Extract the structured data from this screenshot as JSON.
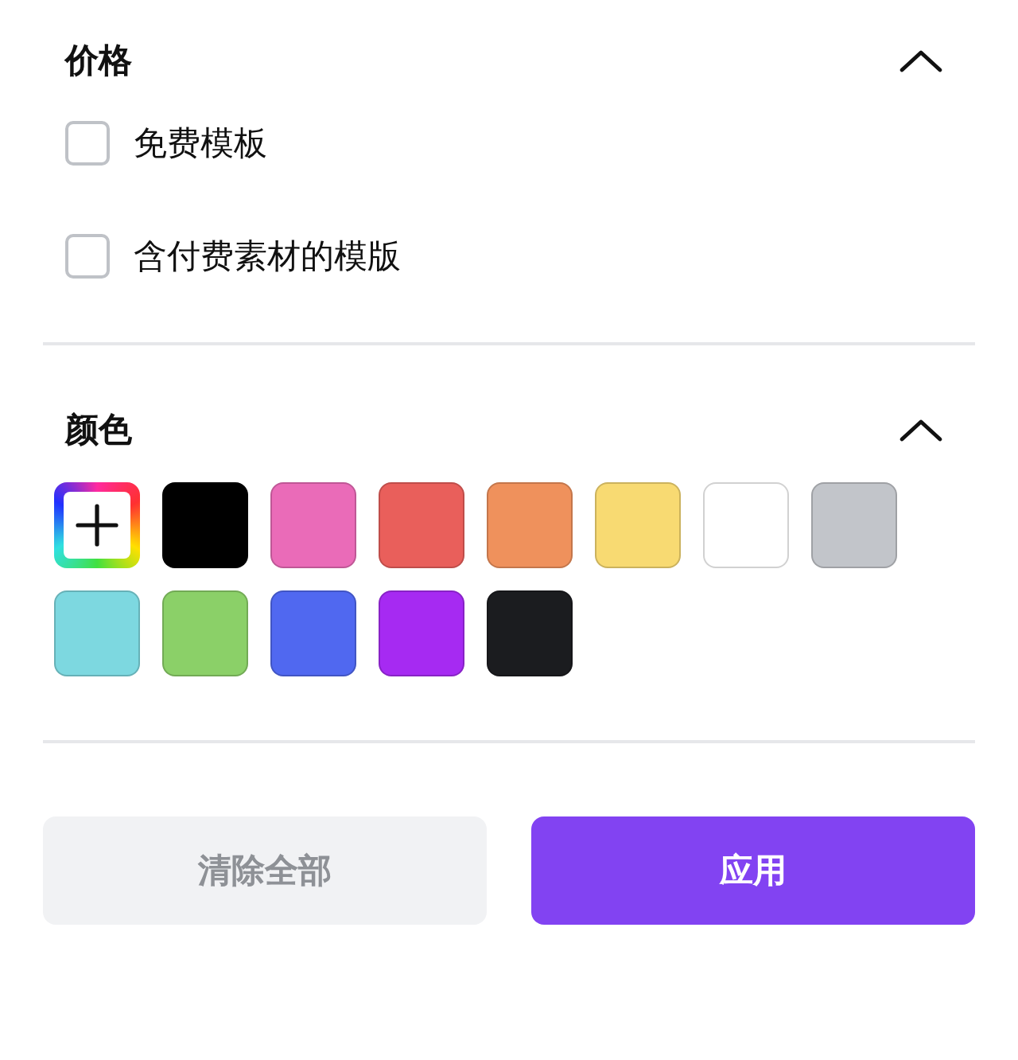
{
  "sections": [
    {
      "title": "价格",
      "expanded": true,
      "kind": "checklist",
      "options": [
        {
          "label": "免费模板",
          "checked": false
        },
        {
          "label": "含付费素材的模版",
          "checked": false
        }
      ]
    },
    {
      "title": "颜色",
      "expanded": true,
      "kind": "swatches",
      "swatches": [
        {
          "kind": "custom",
          "selected": false
        },
        {
          "kind": "color",
          "color": "#000000",
          "selected": false
        },
        {
          "kind": "color",
          "color": "#ea6bb8",
          "selected": false
        },
        {
          "kind": "color",
          "color": "#e95f5b",
          "selected": false
        },
        {
          "kind": "color",
          "color": "#ef915c",
          "selected": false
        },
        {
          "kind": "color",
          "color": "#f8da72",
          "selected": false
        },
        {
          "kind": "color",
          "color": "#ffffff",
          "selected": false
        },
        {
          "kind": "color",
          "color": "#c2c5ca",
          "selected": false
        },
        {
          "kind": "color",
          "color": "#7dd8e0",
          "selected": false
        },
        {
          "kind": "color",
          "color": "#8bd068",
          "selected": false
        },
        {
          "kind": "color",
          "color": "#5068f0",
          "selected": false
        },
        {
          "kind": "color",
          "color": "#a62af2",
          "selected": false
        },
        {
          "kind": "color",
          "color": "#1b1c1f",
          "selected": false
        }
      ]
    }
  ],
  "buttons": [
    {
      "label": "清除全部",
      "kind": "secondary"
    },
    {
      "label": "应用",
      "kind": "primary"
    }
  ]
}
